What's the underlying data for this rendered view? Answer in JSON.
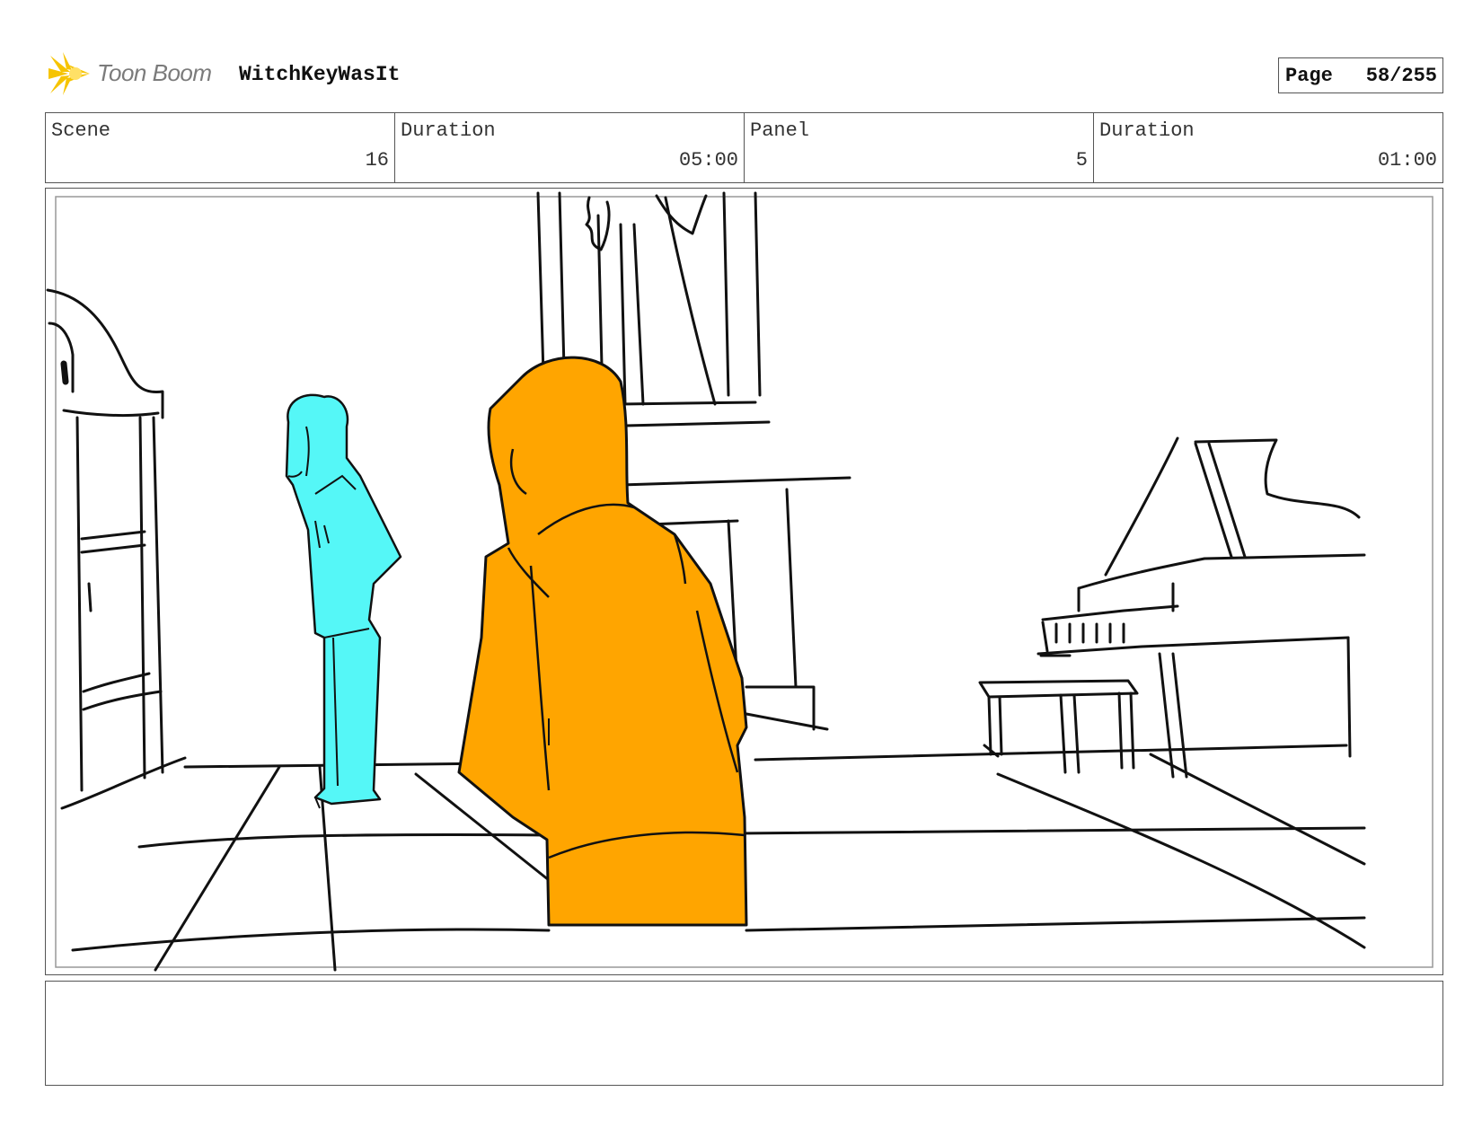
{
  "header": {
    "brand": "Toon Boom",
    "project_title": "WitchKeyWasIt",
    "page_label": "Page",
    "page_number": "58/255"
  },
  "info": {
    "scene_label": "Scene",
    "scene_value": "16",
    "scene_duration_label": "Duration",
    "scene_duration_value": "05:00",
    "panel_label": "Panel",
    "panel_value": "5",
    "panel_duration_label": "Duration",
    "panel_duration_value": "01:00"
  },
  "colors": {
    "foreground_character": "#ffa500",
    "background_character": "#55f7f7",
    "logo_yellow": "#f6c400",
    "line": "#111111"
  },
  "notes": {
    "text": ""
  }
}
